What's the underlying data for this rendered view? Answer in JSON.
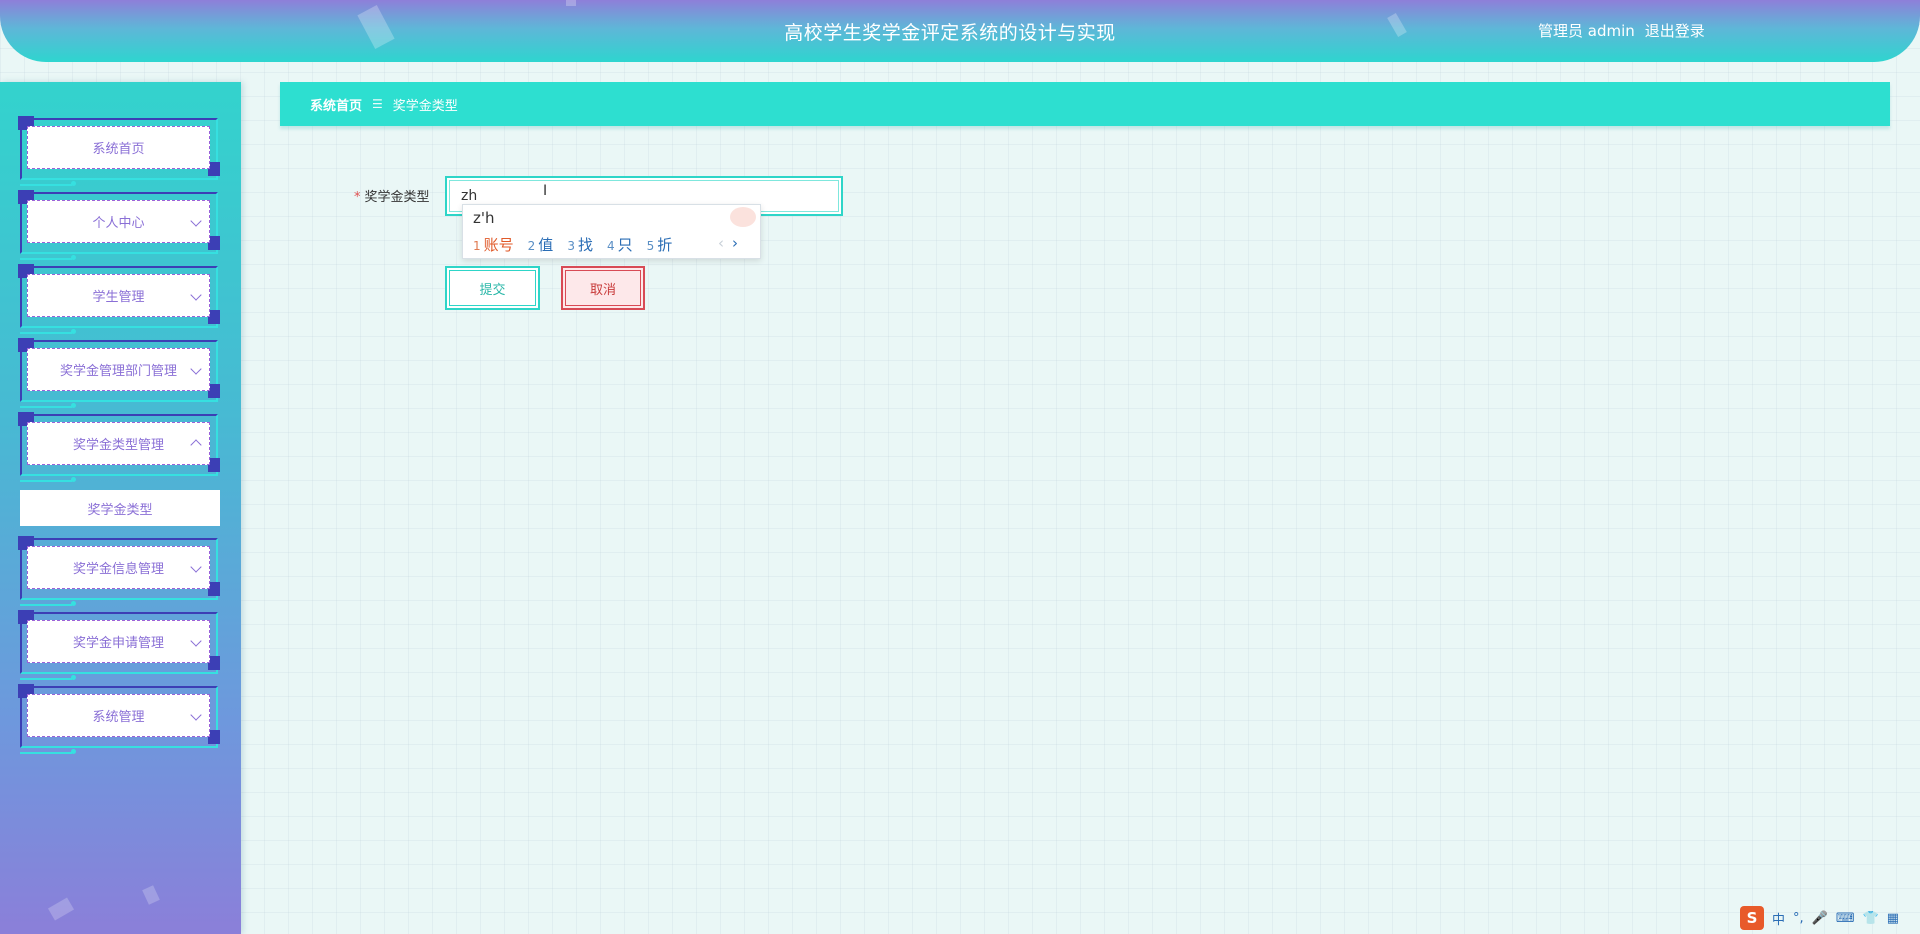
{
  "header": {
    "title": "高校学生奖学金评定系统的设计与实现",
    "user_label": "管理员 admin",
    "logout_label": "退出登录"
  },
  "sidebar": {
    "items": [
      {
        "label": "系统首页",
        "has_chevron": false
      },
      {
        "label": "个人中心",
        "has_chevron": true
      },
      {
        "label": "学生管理",
        "has_chevron": true
      },
      {
        "label": "奖学金管理部门管理",
        "has_chevron": true
      },
      {
        "label": "奖学金类型管理",
        "has_chevron": true,
        "expanded": true
      },
      {
        "label": "奖学金信息管理",
        "has_chevron": true
      },
      {
        "label": "奖学金申请管理",
        "has_chevron": true
      },
      {
        "label": "系统管理",
        "has_chevron": true
      }
    ],
    "submenu": {
      "label": "奖学金类型"
    }
  },
  "breadcrumb": {
    "home": "系统首页",
    "separator": "☰",
    "current": "奖学金类型"
  },
  "form": {
    "required_mark": "*",
    "type_label": "奖学金类型",
    "type_value": "zh",
    "submit_label": "提交",
    "cancel_label": "取消"
  },
  "ime": {
    "composition": "z'h",
    "candidates": [
      {
        "num": "1",
        "text": "账号"
      },
      {
        "num": "2",
        "text": "值"
      },
      {
        "num": "3",
        "text": "找"
      },
      {
        "num": "4",
        "text": "只"
      },
      {
        "num": "5",
        "text": "折"
      }
    ],
    "prev": "‹",
    "next": "›",
    "status": {
      "logo": "S",
      "mode": "中",
      "punct": "°,",
      "mic": "🎤",
      "keyboard": "⌨",
      "skin": "👕",
      "grid": "▦"
    }
  },
  "colors": {
    "accent": "#2ddfd0",
    "sidebar_top": "#33d3cd",
    "sidebar_bottom": "#8b7fd9",
    "menu_text": "#8a6fd6",
    "cancel": "#d84a55"
  }
}
